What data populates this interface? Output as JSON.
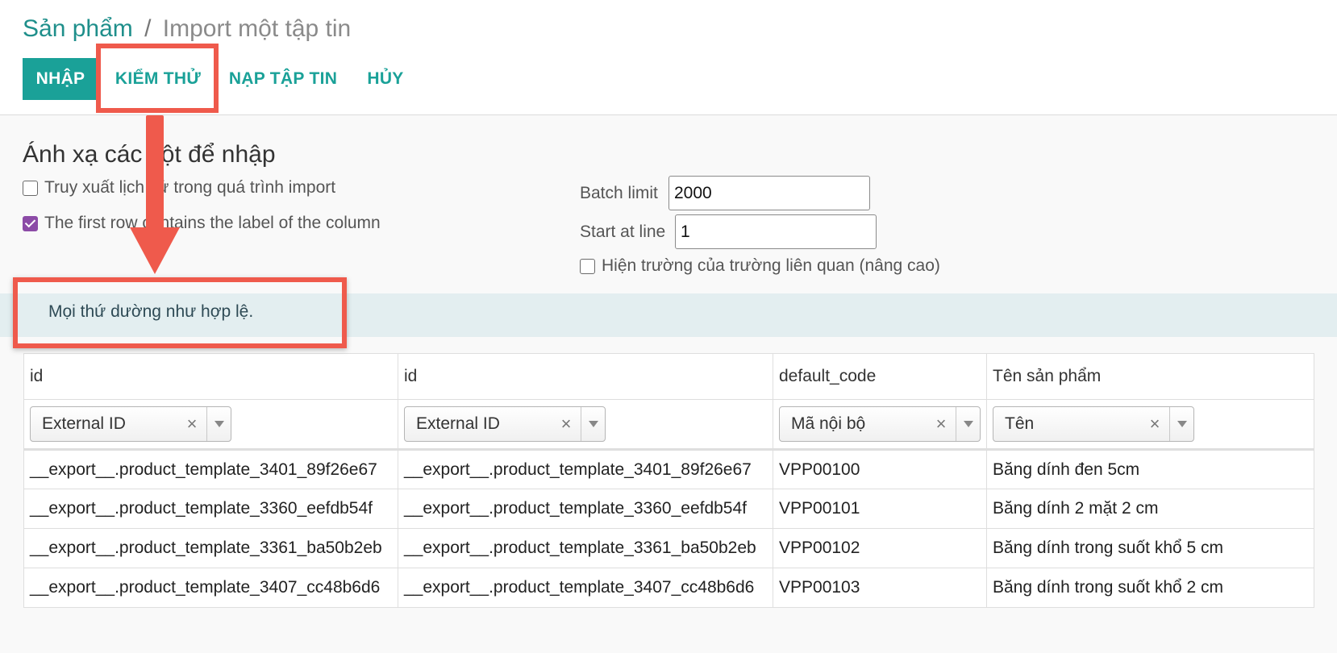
{
  "breadcrumb": {
    "parent": "Sản phẩm",
    "separator": "/",
    "current": "Import một tập tin"
  },
  "toolbar": {
    "import_label": "NHẬP",
    "test_label": "KIỂM THỬ",
    "load_label": "NẠP TẬP TIN",
    "cancel_label": "HỦY"
  },
  "mapping": {
    "title": "Ánh xạ các cột để nhập",
    "tracking_label": "Truy xuất lịch sử trong quá trình import",
    "tracking_checked": false,
    "header_label": "The first row contains the label of the column",
    "header_checked": true
  },
  "options": {
    "batch_limit_label": "Batch limit",
    "batch_limit_value": "2000",
    "start_line_label": "Start at line",
    "start_line_value": "1",
    "advanced_label": "Hiện trường của trường liên quan (nâng cao)",
    "advanced_checked": false
  },
  "alert": {
    "message": "Mọi thứ dường như hợp lệ."
  },
  "grid": {
    "headers": [
      "id",
      "id",
      "default_code",
      "Tên sản phẩm"
    ],
    "mappings": [
      "External ID",
      "External ID",
      "Mã nội bộ",
      "Tên"
    ],
    "clear_glyph": "×",
    "rows": [
      [
        "__export__.product_template_3401_89f26e67",
        "__export__.product_template_3401_89f26e67",
        "VPP00100",
        "Băng dính đen 5cm"
      ],
      [
        "__export__.product_template_3360_eefdb54f",
        "__export__.product_template_3360_eefdb54f",
        "VPP00101",
        "Băng dính 2 mặt 2 cm"
      ],
      [
        "__export__.product_template_3361_ba50b2eb",
        "__export__.product_template_3361_ba50b2eb",
        "VPP00102",
        "Băng dính trong suốt khổ 5 cm"
      ],
      [
        "__export__.product_template_3407_cc48b6d6",
        "__export__.product_template_3407_cc48b6d6",
        "VPP00103",
        "Băng dính trong suốt khổ 2 cm"
      ]
    ]
  },
  "colors": {
    "accent": "#1aa198",
    "checkbox": "#8c4ba7",
    "annotation": "#ef5a4c",
    "alert_bg": "#e3eef0"
  },
  "icons": {
    "dropdown": "chevron-down-icon",
    "clear": "close-icon",
    "arrow": "arrow-down-icon"
  }
}
